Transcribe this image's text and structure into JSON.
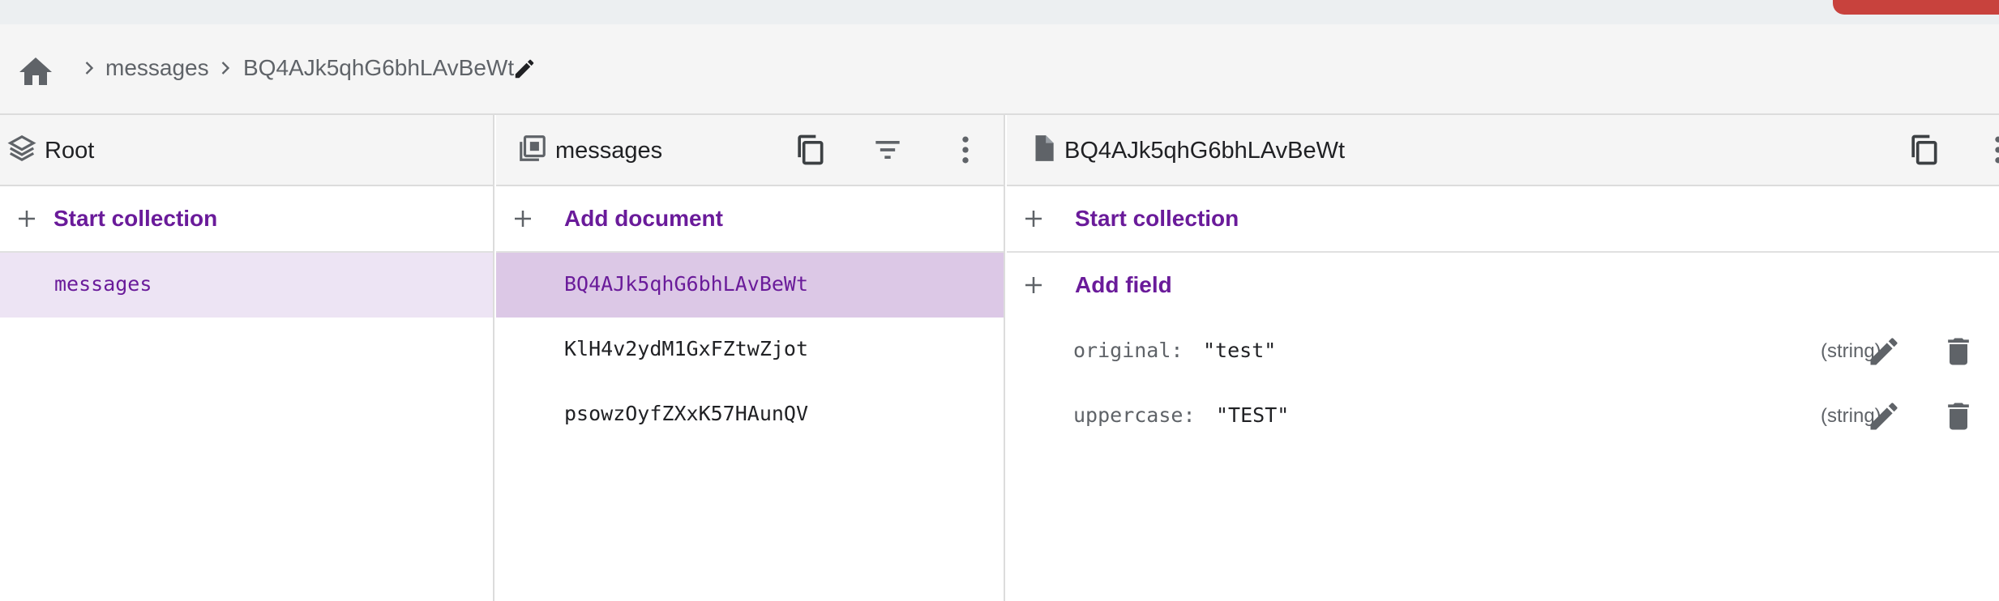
{
  "breadcrumb": {
    "home_icon": "home-icon",
    "items": [
      "messages",
      "BQ4AJk5qhG6bhLAvBeWt"
    ],
    "edit_icon": "pencil-icon"
  },
  "panels": {
    "root": {
      "title": "Root",
      "icon": "layers-icon",
      "action_label": "Start collection",
      "items": [
        "messages"
      ]
    },
    "collection": {
      "title": "messages",
      "icon": "collection-icon",
      "action_label": "Add document",
      "items": [
        "BQ4AJk5qhG6bhLAvBeWt",
        "KlH4v2ydM1GxFZtwZjot",
        "psowzOyfZXxK57HAunQV"
      ]
    },
    "document": {
      "title": "BQ4AJk5qhG6bhLAvBeWt",
      "icon": "document-icon",
      "action_label": "Start collection",
      "add_field_label": "Add field",
      "fields": [
        {
          "key": "original:",
          "value": "\"test\"",
          "type": "(string)"
        },
        {
          "key": "uppercase:",
          "value": "\"TEST\"",
          "type": "(string)"
        }
      ]
    }
  },
  "colors": {
    "accent": "#6a1b9a",
    "selected_light": "#ede4f4",
    "selected_strong": "#dcc8e6",
    "header_bg": "#f5f5f5",
    "top_button": "#c8423d"
  }
}
